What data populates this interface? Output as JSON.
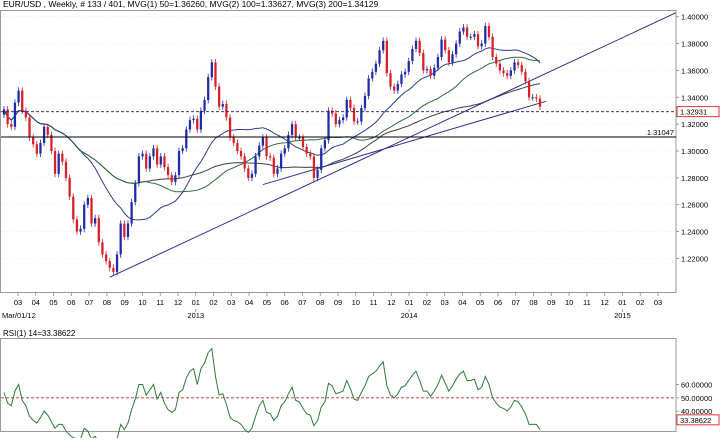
{
  "header": {
    "symbol": "EUR/USD",
    "timeframe": "Weekly",
    "bar_info": "# 133 / 401",
    "ma1_label": "MVG(1) 50=1.36260",
    "ma2_label": "MVG(2) 100=1.33627",
    "ma3_label": "MVG(3) 200=1.34129"
  },
  "rsi_header": "RSI(1) 14=33.38622",
  "colors": {
    "bull": "#1f2aa8",
    "bear": "#d81f26",
    "ma50": "#2a3f8f",
    "ma100": "#2f6b3a",
    "ma200": "#3d3d3d",
    "trend": "#2b2f8f",
    "rsi": "#2d7a3a",
    "refline": "#c0262c",
    "grid": "#e3e3e3"
  },
  "chart_data": [
    {
      "type": "candlestick",
      "title": "EUR/USD Weekly",
      "ylim": [
        1.195,
        1.405
      ],
      "y_ticks": [
        "1.40000",
        "1.38000",
        "1.36000",
        "1.34000",
        "1.32000",
        "1.30000",
        "1.28000",
        "1.26000",
        "1.24000",
        "1.22000"
      ],
      "x_months": [
        "03",
        "04",
        "05",
        "06",
        "07",
        "08",
        "09",
        "10",
        "11",
        "12",
        "01",
        "02",
        "03",
        "04",
        "05",
        "06",
        "07",
        "08",
        "09",
        "10",
        "11",
        "12",
        "01",
        "02",
        "03",
        "04",
        "05",
        "06",
        "07",
        "08",
        "09",
        "10",
        "11",
        "12",
        "01",
        "02",
        "03"
      ],
      "x_years": [
        "Mar/01/12",
        "2013",
        "2014",
        "2015"
      ],
      "current_price": "1.32931",
      "level_price": "1.31047",
      "moving_averages": [
        {
          "name": "MVG(1) 50",
          "value": 1.3626
        },
        {
          "name": "MVG(2) 100",
          "value": 1.33627
        },
        {
          "name": "MVG(3) 200",
          "value": 1.34129
        }
      ],
      "candles_close": [
        1.331,
        1.32,
        1.318,
        1.336,
        1.345,
        1.33,
        1.325,
        1.31,
        1.305,
        1.298,
        1.306,
        1.318,
        1.312,
        1.3,
        1.283,
        1.298,
        1.292,
        1.28,
        1.266,
        1.249,
        1.24,
        1.242,
        1.26,
        1.265,
        1.246,
        1.25,
        1.232,
        1.223,
        1.218,
        1.213,
        1.21,
        1.223,
        1.246,
        1.236,
        1.246,
        1.262,
        1.276,
        1.296,
        1.298,
        1.287,
        1.296,
        1.302,
        1.29,
        1.296,
        1.288,
        1.282,
        1.277,
        1.282,
        1.3,
        1.302,
        1.316,
        1.323,
        1.324,
        1.316,
        1.33,
        1.338,
        1.355,
        1.366,
        1.348,
        1.333,
        1.335,
        1.325,
        1.31,
        1.306,
        1.3,
        1.296,
        1.287,
        1.28,
        1.283,
        1.296,
        1.304,
        1.31,
        1.296,
        1.295,
        1.283,
        1.287,
        1.298,
        1.302,
        1.312,
        1.32,
        1.31,
        1.31,
        1.303,
        1.298,
        1.296,
        1.28,
        1.286,
        1.302,
        1.308,
        1.33,
        1.328,
        1.32,
        1.323,
        1.325,
        1.338,
        1.332,
        1.322,
        1.322,
        1.332,
        1.341,
        1.354,
        1.359,
        1.365,
        1.375,
        1.382,
        1.358,
        1.348,
        1.345,
        1.35,
        1.357,
        1.359,
        1.367,
        1.376,
        1.382,
        1.373,
        1.36,
        1.361,
        1.356,
        1.362,
        1.37,
        1.383,
        1.375,
        1.366,
        1.372,
        1.38,
        1.389,
        1.392,
        1.385,
        1.385,
        1.387,
        1.378,
        1.38,
        1.393,
        1.385,
        1.37,
        1.365,
        1.36,
        1.358,
        1.356,
        1.36,
        1.366,
        1.364,
        1.359,
        1.352,
        1.34,
        1.34,
        1.339,
        1.333
      ],
      "rsi": {
        "values": [
          54,
          46,
          44,
          55,
          60,
          48,
          44,
          36,
          33,
          31,
          35,
          40,
          37,
          32,
          27,
          30,
          30,
          25,
          22,
          20,
          19,
          19,
          27,
          25,
          19,
          21,
          16,
          14,
          13,
          12,
          12,
          19,
          30,
          26,
          31,
          41,
          49,
          60,
          60,
          52,
          56,
          60,
          49,
          54,
          46,
          41,
          39,
          41,
          54,
          56,
          65,
          70,
          72,
          60,
          72,
          76,
          84,
          87,
          66,
          52,
          53,
          45,
          35,
          33,
          32,
          30,
          26,
          24,
          27,
          36,
          44,
          48,
          39,
          38,
          33,
          36,
          44,
          47,
          53,
          58,
          48,
          47,
          42,
          38,
          37,
          29,
          33,
          43,
          47,
          61,
          59,
          53,
          54,
          55,
          63,
          57,
          49,
          48,
          54,
          59,
          66,
          68,
          70,
          74,
          77,
          59,
          52,
          50,
          53,
          58,
          59,
          63,
          67,
          70,
          63,
          55,
          55,
          51,
          55,
          60,
          67,
          61,
          55,
          59,
          64,
          68,
          70,
          63,
          63,
          64,
          56,
          58,
          66,
          60,
          50,
          46,
          43,
          42,
          40,
          43,
          48,
          47,
          43,
          38,
          30,
          30,
          30,
          26
        ],
        "current": "33.38622",
        "ylim": [
          25,
          95
        ],
        "y_ticks": [
          "60.00000",
          "50.00000",
          "40.00000"
        ],
        "reference_line": 50
      }
    }
  ]
}
